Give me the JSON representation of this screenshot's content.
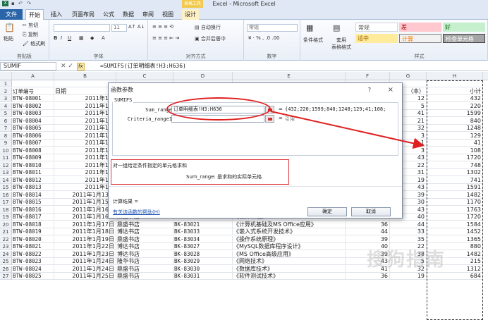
{
  "window": {
    "title": "Excel - Microsoft Excel",
    "context_tab_group": "表格工具"
  },
  "tabs": [
    "文件",
    "开始",
    "插入",
    "页面布局",
    "公式",
    "数据",
    "审阅",
    "视图",
    "设计"
  ],
  "ribbon": {
    "clipboard": {
      "paste": "粘贴",
      "cut": "剪切",
      "copy": "复制",
      "painter": "格式刷",
      "label": "剪贴板"
    },
    "font": {
      "size": "11",
      "label": "字体"
    },
    "align": {
      "wrap": "自动换行",
      "merge": "合并后居中",
      "label": "对齐方式"
    },
    "number": {
      "format": "常规",
      "label": "数字"
    },
    "styles": {
      "cond": "条件格式",
      "table": "套用\n表格格式",
      "normal": "常规",
      "bad": "差",
      "good": "好",
      "neutral": "适中",
      "calc": "计算",
      "check": "检查单元格",
      "label": "样式"
    }
  },
  "formula_bar": {
    "name_box": "SUMIF",
    "formula": "=SUMIFS(订单明细表!H3:H636)"
  },
  "columns": [
    "A",
    "B",
    "C",
    "D",
    "E",
    "F",
    "G",
    "H"
  ],
  "row_numbers": [
    "1",
    "2",
    "3",
    "4",
    "5",
    "6",
    "7",
    "8",
    "9",
    "10",
    "11",
    "12",
    "13",
    "14",
    "15",
    "16",
    "17",
    "18",
    "19",
    "20",
    "21",
    "22",
    "23",
    "24",
    "25",
    "26",
    "27"
  ],
  "header_row": {
    "a": "订单编号",
    "b": "日期",
    "g": "（本）",
    "h": "小计"
  },
  "rows": [
    {
      "a": "BTW-08001",
      "b": "2011年1月",
      "g": "12",
      "h": "432"
    },
    {
      "a": "BTW-08002",
      "b": "2011年1月",
      "g": "5",
      "h": "220"
    },
    {
      "a": "BTW-08003",
      "b": "2011年1月",
      "g": "41",
      "h": "1599"
    },
    {
      "a": "BTW-08004",
      "b": "2011年1月",
      "g": "21",
      "h": "840"
    },
    {
      "a": "BTW-08005",
      "b": "2011年1月",
      "g": "32",
      "h": "1248"
    },
    {
      "a": "BTW-08006",
      "b": "2011年1月",
      "g": "3",
      "h": "129"
    },
    {
      "a": "BTW-08007",
      "b": "2011年1月",
      "g": "1",
      "h": "41"
    },
    {
      "a": "BTW-08008",
      "b": "2011年1月",
      "g": "3",
      "h": "108"
    },
    {
      "a": "BTW-08009",
      "b": "2011年1月",
      "g": "43",
      "h": "1720"
    },
    {
      "a": "BTW-08010",
      "b": "2011年1月",
      "g": "22",
      "h": "748"
    },
    {
      "a": "BTW-08011",
      "b": "2011年1月",
      "g": "31",
      "h": "1302"
    },
    {
      "a": "BTW-08012",
      "b": "2011年1月",
      "g": "19",
      "h": "741"
    },
    {
      "a": "BTW-08013",
      "b": "2011年1月",
      "g": "43",
      "h": "1591"
    },
    {
      "a": "BTW-08014",
      "b": "2011年1月13日",
      "c": "隆华书店",
      "d": "BK-83024",
      "e": "《VB语言程序设计》",
      "f": "38",
      "g": "39",
      "h": "1482"
    },
    {
      "a": "BTW-08015",
      "b": "2011年1月15日",
      "c": "鼎盛书店",
      "d": "BK-83025",
      "e": "《Java语言程序设计》",
      "f": "39",
      "g": "30",
      "h": "1170"
    },
    {
      "a": "BTW-08016",
      "b": "2011年1月16日",
      "c": "鼎盛书店",
      "d": "BK-83026",
      "e": "《Access数据库程序设计》",
      "f": "41",
      "g": "43",
      "h": "1763"
    },
    {
      "a": "BTW-08017",
      "b": "2011年1月16日",
      "c": "鼎盛书店",
      "d": "BK-83037",
      "e": "《软件工程》",
      "f": "43",
      "g": "40",
      "h": "1720"
    },
    {
      "a": "BTW-08018",
      "b": "2011年1月17日",
      "c": "鼎盛书店",
      "d": "BK-83021",
      "e": "《计算机基础及MS Office应用》",
      "f": "36",
      "g": "44",
      "h": "1584"
    },
    {
      "a": "BTW-08019",
      "b": "2011年1月18日",
      "c": "博达书店",
      "d": "BK-83033",
      "e": "《嵌入式系统开发技术》",
      "f": "44",
      "g": "33",
      "h": "1452"
    },
    {
      "a": "BTW-08020",
      "b": "2011年1月19日",
      "c": "鼎盛书店",
      "d": "BK-83034",
      "e": "《操作系统原理》",
      "f": "39",
      "g": "35",
      "h": "1365"
    },
    {
      "a": "BTW-08021",
      "b": "2011年1月22日",
      "c": "博达书店",
      "d": "BK-83027",
      "e": "《MySQL数据库程序设计》",
      "f": "40",
      "g": "22",
      "h": "880"
    },
    {
      "a": "BTW-08022",
      "b": "2011年1月23日",
      "c": "博达书店",
      "d": "BK-83028",
      "e": "《MS Office高级应用》",
      "f": "39",
      "g": "38",
      "h": "1482"
    },
    {
      "a": "BTW-08023",
      "b": "2011年1月24日",
      "c": "隆华书店",
      "d": "BK-83029",
      "e": "《网络技术》",
      "f": "43",
      "g": "5",
      "h": "215"
    },
    {
      "a": "BTW-08024",
      "b": "2011年1月24日",
      "c": "鼎盛书店",
      "d": "BK-83030",
      "e": "《数据库技术》",
      "f": "41",
      "g": "32",
      "h": "1312"
    },
    {
      "a": "BTW-08025",
      "b": "2011年1月25日",
      "c": "鼎盛书店",
      "d": "BK-83031",
      "e": "《软件测试技术》",
      "f": "36",
      "g": "19",
      "h": "684"
    }
  ],
  "dialog": {
    "title": "函数参数",
    "help": "?",
    "close": "×",
    "function_name": "SUMIFS",
    "arg1_label": "Sum_range",
    "arg1_value": "订单明细表!H3:H636",
    "arg1_result": "{432;220;1599;840;1248;129;41;108;",
    "arg2_label": "Criteria_range1",
    "arg2_result": "引用",
    "equals": "=",
    "description": "对一组给定条件指定的单元格求和",
    "arg_description": "Sum_range:  是求和的实际单元格",
    "result_label": "计算结果 =",
    "help_link": "有关该函数的帮助(H)",
    "ok": "确定",
    "cancel": "取消"
  },
  "watermark": "搜狗指南",
  "colors": {
    "annotation": "#e02020",
    "file_tab": "#2a64a9",
    "context_tab": "#f2c94c"
  }
}
